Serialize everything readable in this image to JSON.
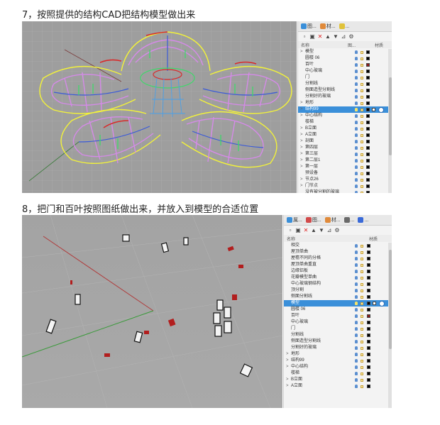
{
  "step7": {
    "caption": "7，按照提供的结构CAD把结构模型做出来",
    "tabs": [
      "图...",
      "材...",
      "..."
    ],
    "header": {
      "name": "名称",
      "col2": "图...",
      "col3": "材质"
    },
    "rows": [
      {
        "name": "模型",
        "exp": ">",
        "color": "#000000"
      },
      {
        "name": "圆楼 06",
        "color": "#000000"
      },
      {
        "name": "百叶",
        "color": "#8b1a1a"
      },
      {
        "name": "中心玻璃",
        "color": "#000000"
      },
      {
        "name": "门",
        "color": "#000000"
      },
      {
        "name": "分割线",
        "color": "#000000"
      },
      {
        "name": "侧面造型分割线",
        "color": "#000000"
      },
      {
        "name": "分割好的玻璃",
        "color": "#000000"
      },
      {
        "name": "地形",
        "exp": ">",
        "color": "#000000"
      },
      {
        "name": "结构99",
        "exp": ">",
        "color": "#000000",
        "selected": true
      },
      {
        "name": "中心结构",
        "exp": ">",
        "color": "#000000"
      },
      {
        "name": "楼梯",
        "color": "#000000"
      },
      {
        "name": "B立面",
        "exp": ">",
        "color": "#000000"
      },
      {
        "name": "A立面",
        "exp": ">",
        "color": "#000000"
      },
      {
        "name": "剖面",
        "exp": ">",
        "color": "#000000"
      },
      {
        "name": "第四层",
        "exp": ">",
        "color": "#000000"
      },
      {
        "name": "第三层",
        "exp": ">",
        "color": "#000000"
      },
      {
        "name": "第二层1",
        "exp": ">",
        "color": "#000000"
      },
      {
        "name": "第一层",
        "exp": ">",
        "color": "#000000"
      },
      {
        "name": "预设备",
        "color": "#000000"
      },
      {
        "name": "节点26",
        "exp": ">",
        "color": "#000000"
      },
      {
        "name": "门节点",
        "exp": ">",
        "color": "#000000"
      },
      {
        "name": "没有被分割的玻璃",
        "color": "#000000"
      }
    ]
  },
  "step8": {
    "caption": "8，把门和百叶按照图纸做出来，并放入到模型的合适位置",
    "tabs": [
      "属...",
      "图...",
      "材...",
      "...",
      "..."
    ],
    "header": {
      "name": "名称",
      "col2": "",
      "col3": "材质"
    },
    "rows": [
      {
        "name": "相交",
        "color": "#000000"
      },
      {
        "name": "屋顶单曲",
        "color": "#000000"
      },
      {
        "name": "屋檐不同的分格",
        "color": "#000000"
      },
      {
        "name": "屋顶单曲重直",
        "color": "#000000"
      },
      {
        "name": "边缘铝板",
        "color": "#000000"
      },
      {
        "name": "花瓣模型单曲",
        "color": "#000000"
      },
      {
        "name": "中心玻璃钢结构",
        "color": "#000000"
      },
      {
        "name": "顶分割",
        "color": "#000000"
      },
      {
        "name": "侧面分割线",
        "color": "#000000"
      },
      {
        "name": "模型",
        "color": "#000000",
        "selected": true
      },
      {
        "name": "圆楼 06",
        "color": "#000000"
      },
      {
        "name": "百叶",
        "color": "#8b1a1a"
      },
      {
        "name": "中心玻璃",
        "color": "#000000"
      },
      {
        "name": "门",
        "color": "#000000"
      },
      {
        "name": "分割线",
        "color": "#000000"
      },
      {
        "name": "侧面造型分割线",
        "color": "#000000"
      },
      {
        "name": "分割好的玻璃",
        "color": "#000000"
      },
      {
        "name": "地形",
        "exp": ">",
        "color": "#000000"
      },
      {
        "name": "结构99",
        "exp": ">",
        "color": "#000000"
      },
      {
        "name": "中心结构",
        "exp": ">",
        "color": "#000000"
      },
      {
        "name": "楼梯",
        "color": "#000000"
      },
      {
        "name": "B立面",
        "exp": ">",
        "color": "#000000"
      },
      {
        "name": "A立面",
        "exp": ">",
        "color": "#000000"
      }
    ]
  }
}
